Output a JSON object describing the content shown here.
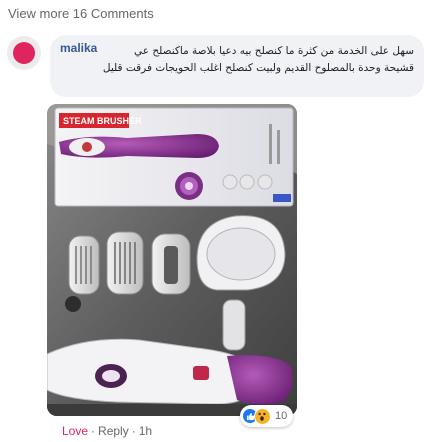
{
  "comments": {
    "view_more_label": "View more 16 Comments"
  },
  "comment": {
    "author": "malika",
    "text_line1": "سهل على الخدمة من كثرة ما كنصلح بيه دعيا بلاصة ماكنصلح عي",
    "text_line2": "قشيحة وحدة بالمصلوح القديم ولبيت كنصلح اغلب الحويجات فرقت قليل",
    "reaction_count": "10",
    "reaction_icons": [
      "like-icon",
      "wow-icon"
    ],
    "actions": {
      "love_label": "Love",
      "reply_label": "Reply",
      "time_label": "1h",
      "separator": "·"
    },
    "photo": {
      "box_label": "STEAM BRUSHER"
    }
  },
  "colors": {
    "link": "#385898",
    "love": "#e0245e",
    "muted": "#65676b",
    "bubble": "#f0f2f5",
    "like_blue": "#1877f2",
    "wow_yellow": "#f7b125"
  }
}
